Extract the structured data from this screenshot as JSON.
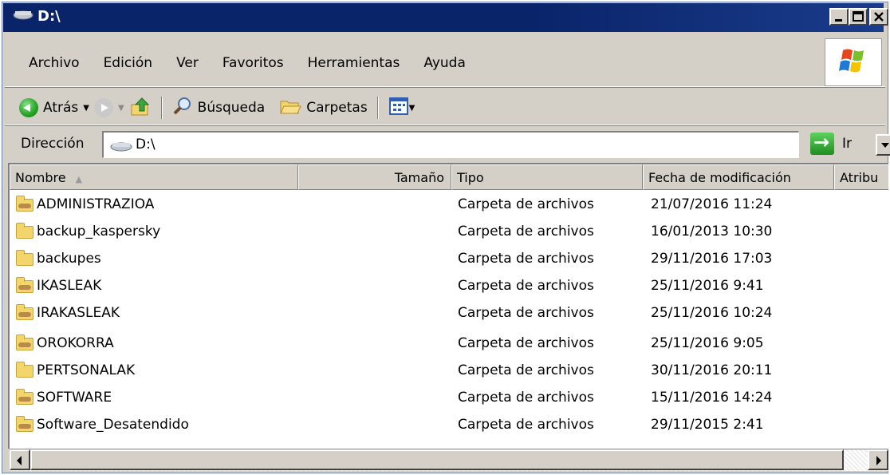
{
  "window": {
    "title": "D:\\"
  },
  "menu": [
    {
      "label": "Archivo"
    },
    {
      "label": "Edición"
    },
    {
      "label": "Ver"
    },
    {
      "label": "Favoritos"
    },
    {
      "label": "Herramientas"
    },
    {
      "label": "Ayuda"
    }
  ],
  "toolbar": {
    "back_label": "Atrás",
    "search_label": "Búsqueda",
    "folders_label": "Carpetas"
  },
  "address": {
    "label": "Dirección",
    "value": "D:\\",
    "go_label": "Ir"
  },
  "columns": {
    "name": "Nombre",
    "size": "Tamaño",
    "type": "Tipo",
    "modified": "Fecha de modificación",
    "attributes": "Atribu"
  },
  "files": [
    {
      "name": "ADMINISTRAZIOA",
      "type": "Carpeta de archivos",
      "modified": "21/07/2016 11:24",
      "shared": true
    },
    {
      "name": "backup_kaspersky",
      "type": "Carpeta de archivos",
      "modified": "16/01/2013 10:30",
      "shared": false
    },
    {
      "name": "backupes",
      "type": "Carpeta de archivos",
      "modified": "29/11/2016 17:03",
      "shared": false
    },
    {
      "name": "IKASLEAK",
      "type": "Carpeta de archivos",
      "modified": "25/11/2016 9:41",
      "shared": true
    },
    {
      "name": "IRAKASLEAK",
      "type": "Carpeta de archivos",
      "modified": "25/11/2016 10:24",
      "shared": true
    },
    {
      "name": "OROKORRA",
      "type": "Carpeta de archivos",
      "modified": "25/11/2016 9:05",
      "shared": true
    },
    {
      "name": "PERTSONALAK",
      "type": "Carpeta de archivos",
      "modified": "30/11/2016 20:11",
      "shared": false
    },
    {
      "name": "SOFTWARE",
      "type": "Carpeta de archivos",
      "modified": "15/11/2016 14:24",
      "shared": true
    },
    {
      "name": "Software_Desatendido",
      "type": "Carpeta de archivos",
      "modified": "29/11/2015 2:41",
      "shared": true
    }
  ],
  "icons": {
    "drive": "drive-icon",
    "back": "back-arrow-icon",
    "forward": "forward-arrow-icon",
    "up": "up-folder-icon",
    "search": "search-icon",
    "folders": "folders-icon",
    "views": "views-icon",
    "go": "go-arrow-icon",
    "folder": "folder-icon",
    "windows_logo": "windows-logo-icon"
  },
  "colors": {
    "title_bar": "#0a246a",
    "chrome": "#d4d0c8",
    "folder": "#f2d66b"
  }
}
